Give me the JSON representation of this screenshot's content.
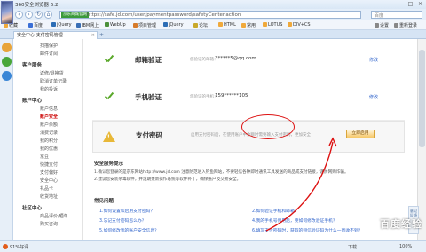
{
  "window": {
    "title": "360安全浏览器 6.2",
    "controls": [
      "min",
      "max",
      "close"
    ]
  },
  "address": {
    "secure_tag": "京东商城官网",
    "url": "https://safe.jd.com/user/paymentpassword/safetyCenter.action",
    "search_placeholder": "百度"
  },
  "bookmarks": [
    {
      "label": "收藏",
      "color": "#f0a93b"
    },
    {
      "label": "百度",
      "color": "#3b6fd6"
    },
    {
      "label": "jQuery",
      "color": "#2c6db5"
    },
    {
      "label": "IBM网上",
      "color": "#3a6fb5"
    },
    {
      "label": "WebUp",
      "color": "#4a8f3a"
    },
    {
      "label": "项目管理",
      "color": "#d67a2a"
    },
    {
      "label": "jQuery",
      "color": "#2c6db5"
    },
    {
      "label": "论坛",
      "color": "#c8a82a"
    },
    {
      "label": "HTML",
      "color": "#f0a93b"
    },
    {
      "label": "常用",
      "color": "#f0a93b"
    },
    {
      "label": "LOTUS",
      "color": "#f0a93b"
    },
    {
      "label": "DIV+CS",
      "color": "#f0a93b"
    },
    {
      "label": "设置",
      "color": "#888888"
    },
    {
      "label": "重新登录",
      "color": "#888888"
    }
  ],
  "tab": {
    "label": "安全中心-支付密码管理"
  },
  "leftnav": {
    "items": [
      {
        "label": "扫描保护",
        "type": "item"
      },
      {
        "label": "邮件订阅",
        "type": "item"
      },
      {
        "label": "客户服务",
        "type": "group"
      },
      {
        "label": "返修/退换货",
        "type": "item"
      },
      {
        "label": "取消订单记录",
        "type": "item"
      },
      {
        "label": "我的投诉",
        "type": "item"
      },
      {
        "label": "账户中心",
        "type": "group"
      },
      {
        "label": "账户信息",
        "type": "item"
      },
      {
        "label": "账户安全",
        "type": "item",
        "active": true
      },
      {
        "label": "账户余额",
        "type": "item"
      },
      {
        "label": "消费记录",
        "type": "item"
      },
      {
        "label": "我的积分",
        "type": "item"
      },
      {
        "label": "我的优惠",
        "type": "item"
      },
      {
        "label": "京豆",
        "type": "item"
      },
      {
        "label": "快捷支付",
        "type": "item"
      },
      {
        "label": "支付偏好",
        "type": "item"
      },
      {
        "label": "安全中心",
        "type": "item"
      },
      {
        "label": "礼品卡",
        "type": "item"
      },
      {
        "label": "收货地址",
        "type": "item"
      },
      {
        "label": "社区中心",
        "type": "group"
      },
      {
        "label": "商品评价/晒单",
        "type": "item"
      },
      {
        "label": "购买咨询",
        "type": "item"
      }
    ]
  },
  "verifications": {
    "email": {
      "title": "邮箱验证",
      "label": "您验证的邮箱：",
      "value": "3*****5@qq.com",
      "link": "修改"
    },
    "phone": {
      "title": "手机验证",
      "label": "您验证的手机：",
      "value": "159******105",
      "link": "修改"
    },
    "paypwd": {
      "title": "支付密码",
      "desc": "启用支付密码后，在使用账户中余额时需要输入支付密码，更加安全",
      "button": "立即启用"
    }
  },
  "tips": {
    "title": "安全服务提示",
    "lines": [
      "1.确认您登录的是京东网站http://www.jd.com 注意防范进入钓鱼网站，不要轻信各种即时通讯工具发送的商品或支付链接，谨防网购诈骗。",
      "2.建议您安装杀毒软件，并定期更新操作系统等软件补丁，确保账户及交易安全。"
    ]
  },
  "faq": {
    "title": "常见问题",
    "links": [
      "1.如何设置和启用支付密码？",
      "2.如何验证手机和邮箱？",
      "3.忘记支付密码怎么办？",
      "4.我的手机号停用后，要如何修改验证手机？",
      "5.如何修改我的账户安全信息？",
      "6.填写支付密码时，获取的短信验证码为什么一直收不到？"
    ]
  },
  "status": {
    "left": "91%好评",
    "items": [
      "下载",
      "100%"
    ]
  },
  "feedback": "意见反馈",
  "watermark": "百度经验"
}
